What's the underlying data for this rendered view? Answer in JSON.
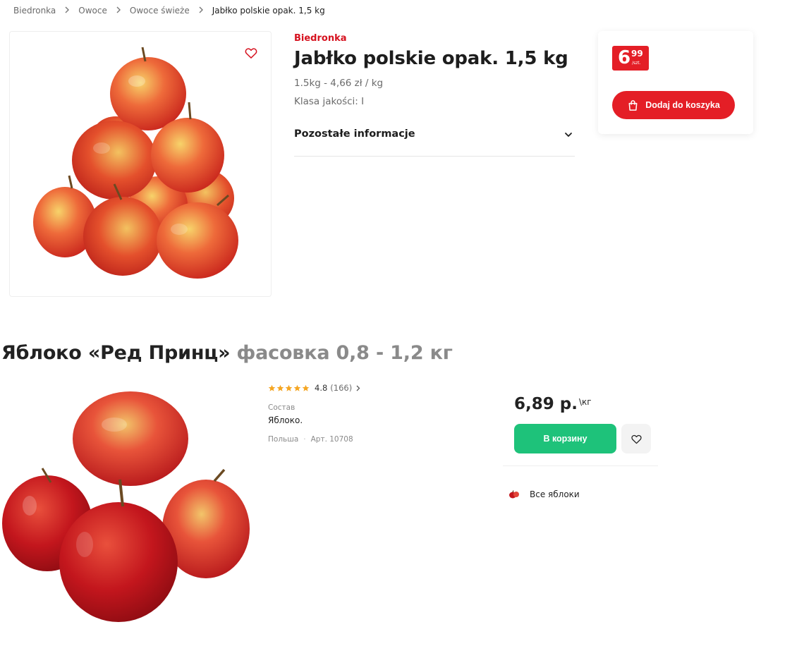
{
  "top_product": {
    "breadcrumb": [
      "Biedronka",
      "Owoce",
      "Owoce świeże",
      "Jabłko polskie opak. 1,5 kg"
    ],
    "brand": "Biedronka",
    "title": "Jabłko polskie opak. 1,5 kg",
    "weight_info": "1.5kg - 4,66 zł / kg",
    "quality_class": "Klasa jakości: I",
    "accordion_label": "Pozostałe informacje",
    "price": {
      "main": "6",
      "cents": "99",
      "unit": "/szt."
    },
    "add_to_cart_label": "Dodaj do koszyka",
    "icons": [
      "heart-icon",
      "chevron-down-icon",
      "shopping-bag-icon",
      "chevron-right-icon"
    ],
    "colors": {
      "brand_red": "#e41e26",
      "brand_text_red": "#d6121f"
    }
  },
  "bottom_product": {
    "title_main": "Яблоко «Ред Принц»",
    "title_pack": "фасовка 0,8 - 1,2 кг",
    "rating": {
      "score": "4.8",
      "count": "(166)",
      "stars": 5
    },
    "composition_label": "Состав",
    "composition_value": "Яблоко.",
    "origin_country": "Польша",
    "origin_sep": "·",
    "article": "Арт. 10708",
    "price": "6,89 р.",
    "price_unit": "\\кг",
    "cart_label": "В корзину",
    "all_link": "Все яблоки",
    "icons": [
      "star-icon",
      "heart-icon",
      "apple-icon",
      "chevron-right-icon"
    ],
    "colors": {
      "accent_green": "#1ec27a",
      "star": "#f5a623"
    }
  }
}
